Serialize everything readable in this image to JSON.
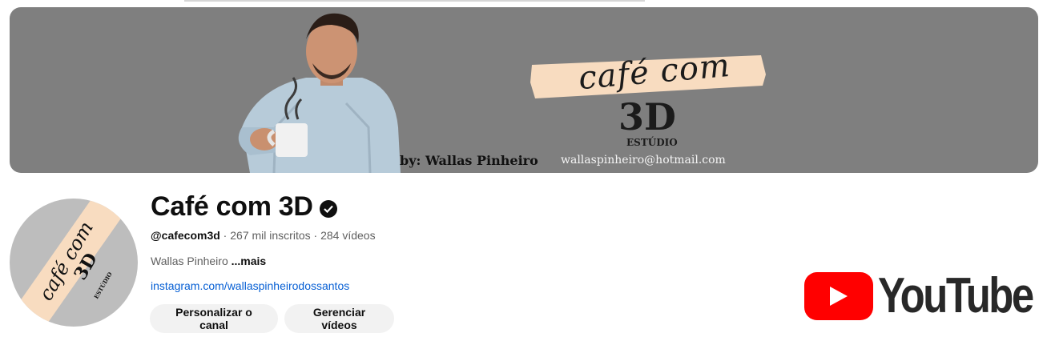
{
  "banner": {
    "brand_line1": "café com",
    "brand_line2": "3D",
    "brand_line3": "ESTÚDIO",
    "author": "by: Wallas Pinheiro",
    "email": "wallaspinheiro@hotmail.com"
  },
  "avatar": {
    "line1": "café com",
    "line2": "3D",
    "line3": "ESTÚDIO"
  },
  "channel": {
    "name": "Café com 3D",
    "verified": true,
    "handle": "@cafecom3d",
    "subscribers": "267 mil inscritos",
    "videos": "284 vídeos",
    "separator": " · ",
    "description": "Wallas Pinheiro",
    "more_label": "...mais",
    "link": "instagram.com/wallaspinheirodossantos"
  },
  "actions": {
    "customize_label": "Personalizar o canal",
    "manage_label": "Gerenciar vídeos"
  },
  "logo": {
    "wordmark": "YouTube"
  },
  "colors": {
    "banner_bg": "#7f7f7f",
    "accent_peach": "#f8dcc0",
    "link": "#065fd4",
    "youtube_red": "#ff0000"
  },
  "icons": [
    "verified-check-icon",
    "play-icon"
  ]
}
